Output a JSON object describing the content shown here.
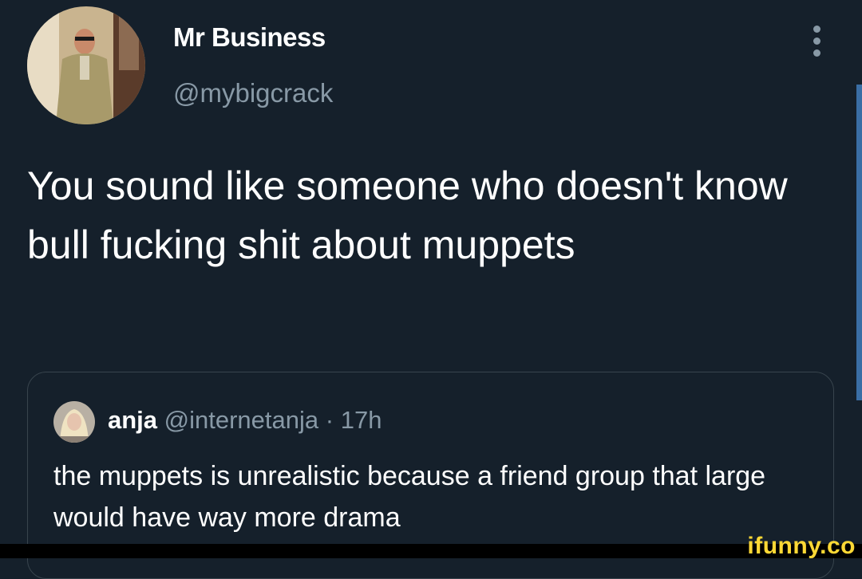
{
  "tweet": {
    "author": {
      "display_name": "Mr Business",
      "handle": "@mybigcrack",
      "avatar_icon": "profile-photo"
    },
    "text": "You sound like someone who doesn't know bull fucking shit about muppets",
    "more_icon": "more-vertical-icon"
  },
  "quoted_tweet": {
    "author": {
      "display_name": "anja",
      "handle": "@internetanja",
      "avatar_icon": "profile-photo"
    },
    "separator": "·",
    "time": "17h",
    "text": "the muppets is unrealistic because a friend group that large would have way more drama"
  },
  "watermark": {
    "text": "ifunny.co"
  },
  "colors": {
    "background": "#15202b",
    "primary_text": "#ffffff",
    "secondary_text": "#8899a6",
    "border": "#38444d",
    "watermark": "#fdd835",
    "scroll_indicator": "#3a6ea5"
  }
}
